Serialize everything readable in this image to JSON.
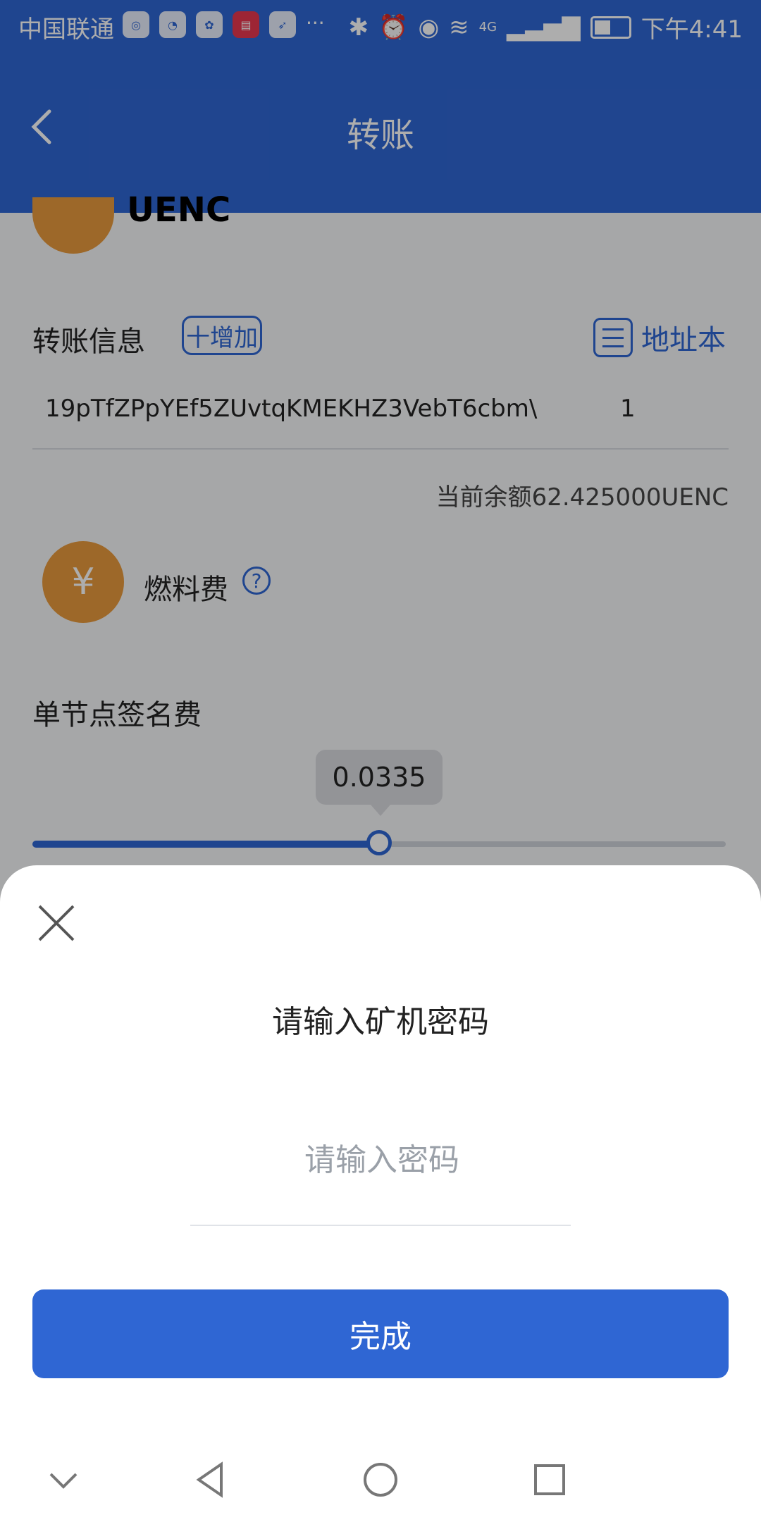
{
  "status_bar": {
    "carrier": "中国联通",
    "time": "下午4:41",
    "network": "4G",
    "app_icons": [
      "browser-icon",
      "clock-app-icon",
      "paw-app-icon",
      "news-app-icon",
      "bird-app-icon"
    ],
    "more": "···"
  },
  "header": {
    "title": "转账"
  },
  "coin": {
    "name": "UENC"
  },
  "transfer_info": {
    "label": "转账信息",
    "add_button": "十增加",
    "address_book": "地址本",
    "address": "19pTfZPpYEf5ZUvtqKMEKHZ3VebT6cbm\\",
    "amount": "1",
    "balance_text": "当前余额62.425000UENC"
  },
  "fee": {
    "icon": "¥",
    "label": "燃料费",
    "help": "?",
    "node_fee_label": "单节点签名费",
    "slider_value": "0.0335",
    "slider_fraction": 0.5
  },
  "sheet": {
    "title": "请输入矿机密码",
    "password_placeholder": "请输入密码",
    "done_button": "完成"
  },
  "colors": {
    "accent": "#2f66d3",
    "coin": "#e79a3d"
  }
}
